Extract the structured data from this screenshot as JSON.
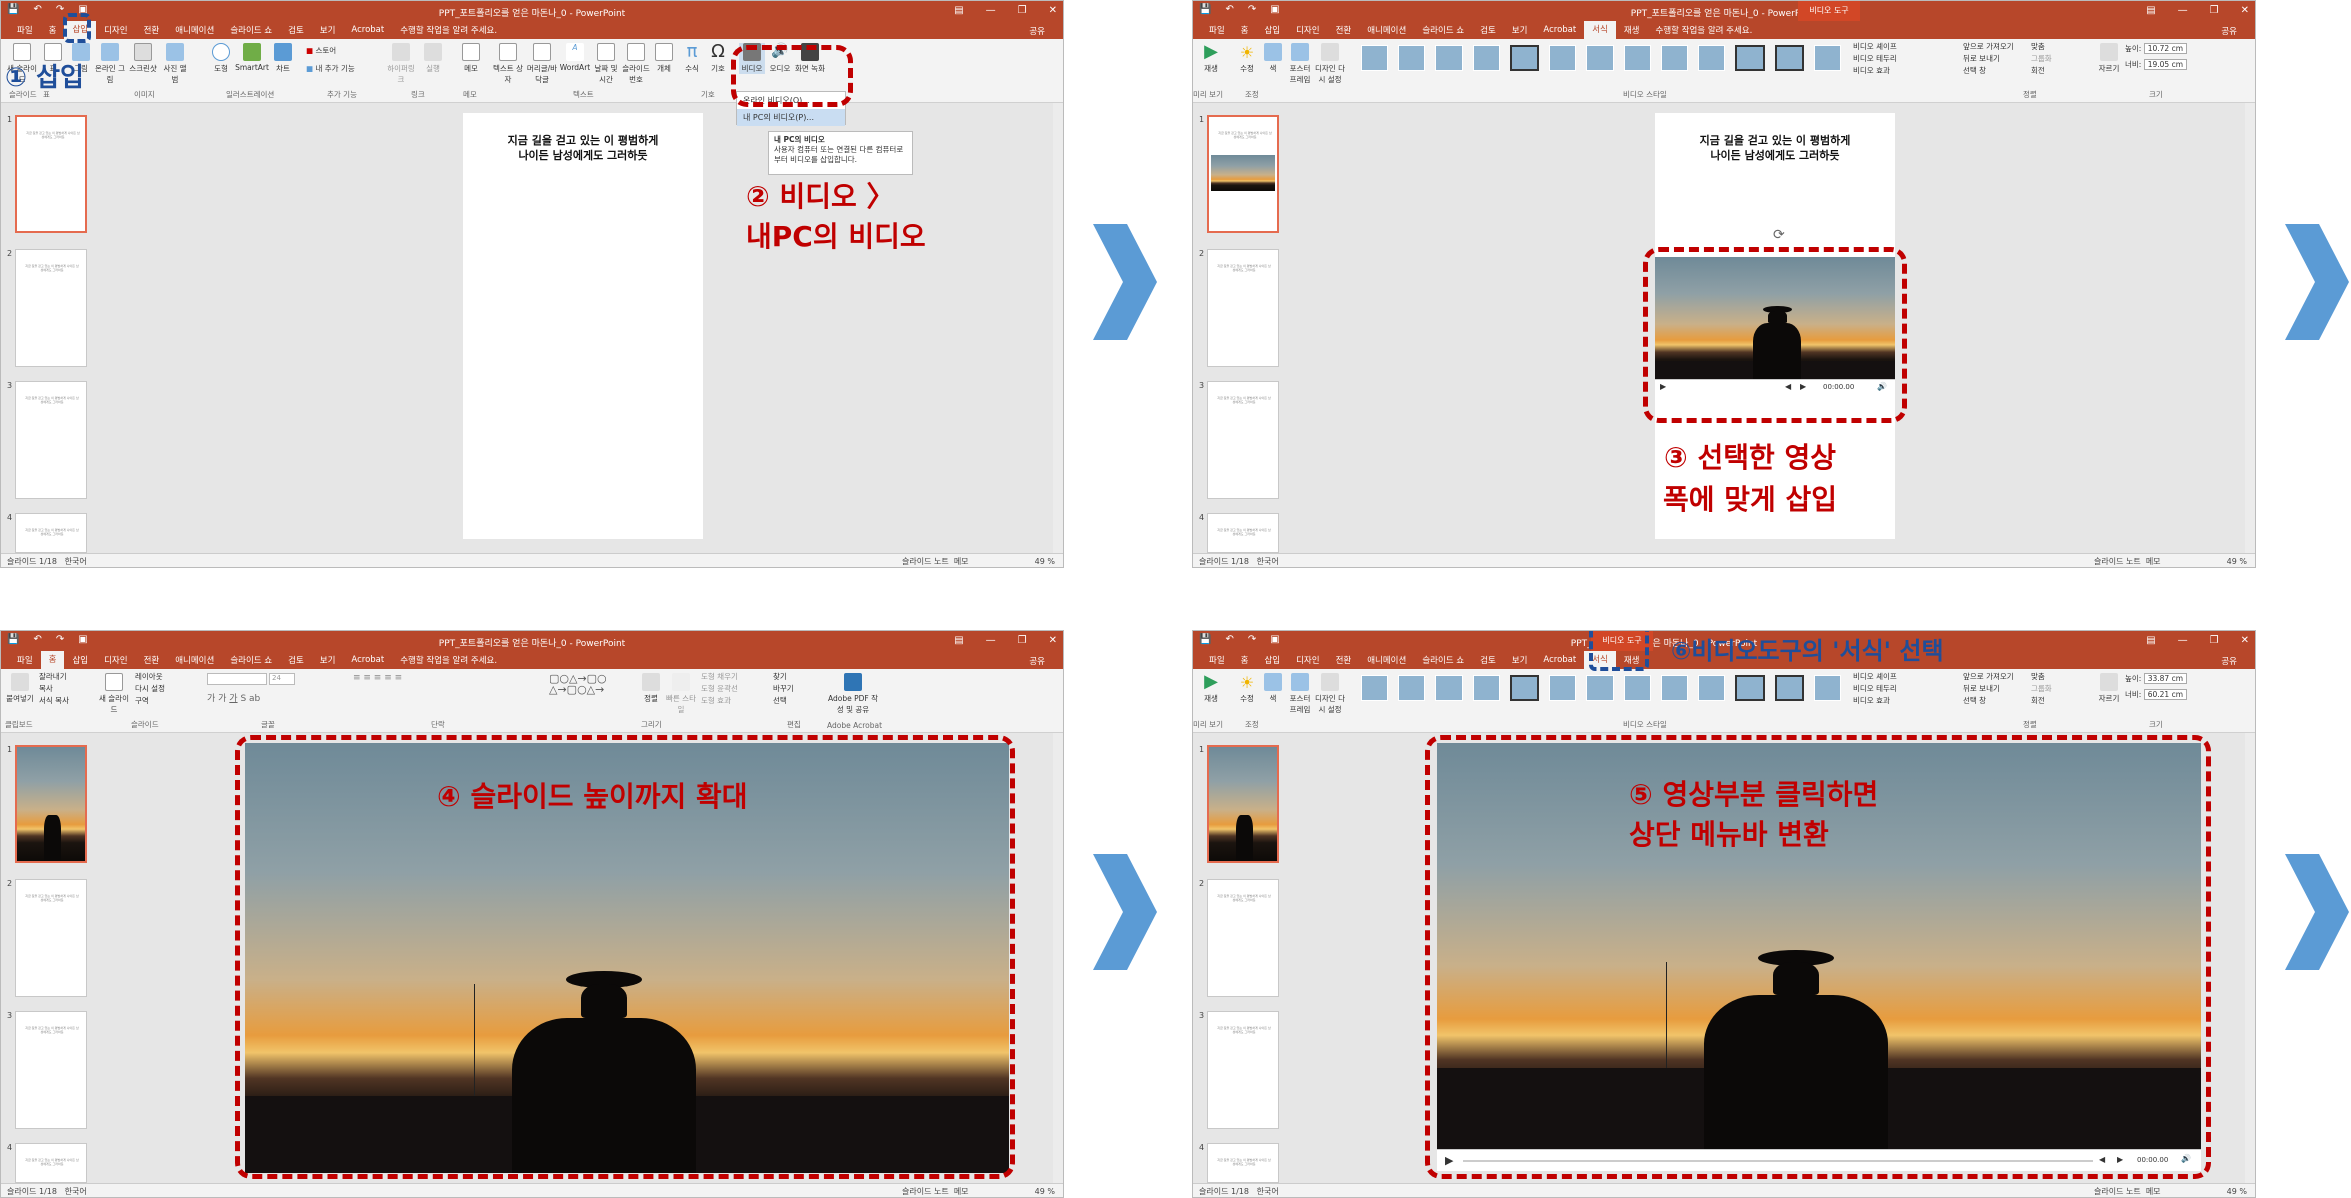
{
  "app": {
    "title_p1": "PPT_포트폴리오를 얻은 마돈나_0 - PowerPoint",
    "title_p2": "PPT_포트폴리오를 얻은 마돈나_0 - PowerPoint",
    "title_p3": "PPT_포트폴리오를 얻은 마돈나_0 - PowerPoint",
    "title_p4": "PPT_포트폴리오를 얻은 마돈나_0 - PowerPoint",
    "video_tools": "비디오 도구",
    "share": "공유",
    "tellme": "수행할 작업을 알려 주세요."
  },
  "tabs_insert": [
    "파일",
    "홈",
    "삽입",
    "디자인",
    "전환",
    "애니메이션",
    "슬라이드 쇼",
    "검토",
    "보기",
    "Acrobat"
  ],
  "tabs_video": [
    "파일",
    "홈",
    "삽입",
    "디자인",
    "전환",
    "애니메이션",
    "슬라이드 쇼",
    "검토",
    "보기",
    "Acrobat",
    "서식",
    "재생"
  ],
  "tabs_home": [
    "파일",
    "홈",
    "삽입",
    "디자인",
    "전환",
    "애니메이션",
    "슬라이드 쇼",
    "검토",
    "보기",
    "Acrobat"
  ],
  "ribbon_insert": {
    "groups": [
      "슬라이드",
      "표",
      "이미지",
      "일러스트레이션",
      "추가 기능",
      "링크",
      "메모",
      "텍스트",
      "기호",
      "미디어"
    ],
    "buttons": [
      "새 슬라이드",
      "표",
      "그림",
      "온라인 그림",
      "스크린샷",
      "사진 앨범",
      "도형",
      "SmartArt",
      "차트",
      "스토어",
      "내 추가 기능",
      "하이퍼링크",
      "실행",
      "메모",
      "텍스트 상자",
      "머리글/바닥글",
      "WordArt",
      "날짜 및 시간",
      "슬라이드 번호",
      "개체",
      "수식",
      "기호",
      "비디오",
      "오디오",
      "화면 녹화"
    ],
    "video_menu": [
      "온라인 비디오(O)...",
      "내 PC의 비디오(P)..."
    ],
    "tooltip_title": "내 PC의 비디오",
    "tooltip_body": "사용자 컴퓨터 또는 연결된 다른 컴퓨터로부터 비디오를 삽입합니다."
  },
  "ribbon_video": {
    "groups": [
      "미리 보기",
      "조정",
      "비디오 스타일",
      "정렬",
      "크기"
    ],
    "buttons": [
      "재생",
      "수정",
      "색",
      "포스터 프레임",
      "디자인 다시 설정",
      "비디오 셰이프",
      "비디오 테두리",
      "비디오 효과",
      "앞으로 가져오기",
      "뒤로 보내기",
      "선택 창",
      "맞춤",
      "그룹화",
      "회전",
      "자르기"
    ],
    "height_p2": "10.72 cm",
    "width_p2": "19.05 cm",
    "height_p4": "33.87 cm",
    "width_p4": "60.21 cm",
    "height_label": "높이:",
    "width_label": "너비:"
  },
  "ribbon_home": {
    "groups": [
      "클립보드",
      "슬라이드",
      "글꼴",
      "단락",
      "그리기",
      "편집",
      "Adobe Acrobat"
    ],
    "buttons": [
      "붙여넣기",
      "잘라내기",
      "복사",
      "서식 복사",
      "새 슬라이드",
      "레이아웃",
      "다시 설정",
      "구역",
      "정렬",
      "빠른 스타일",
      "도형 채우기",
      "도형 윤곽선",
      "도형 효과",
      "찾기",
      "바꾸기",
      "선택",
      "Adobe PDF 작성 및 공유"
    ],
    "font_size": "24"
  },
  "slide_text": [
    "지금 길을 걷고 있는 이 평범하게",
    "나이든 남성에게도 그러하듯"
  ],
  "thumb_text": "지금 길을 걷고 있는 이 평범하게 나이든 남성에게도 그러하듯",
  "thumb_numbers": [
    "1",
    "2",
    "3",
    "4"
  ],
  "video_time": "00:00.00",
  "status": {
    "slide": "슬라이드 1/18",
    "lang": "한국어",
    "notes": "슬라이드 노트",
    "comments": "메모",
    "zoom": "49 %"
  },
  "annotations": {
    "a1": "① 삽입",
    "a2_line1": "② 비디오 〉",
    "a2_line2": "내PC의 비디오",
    "a3_line1": "③ 선택한 영상",
    "a3_line2": "폭에 맞게 삽입",
    "a4": "④ 슬라이드 높이까지 확대",
    "a5_line1": "⑤ 영상부분 클릭하면",
    "a5_line2": "상단 메뉴바 변환",
    "a6": "⑥비디오도구의 '서식' 선택"
  },
  "colors": {
    "ppt_red": "#b7472a",
    "annotation_red": "#c00000",
    "arrow_blue": "#5b9bd5"
  }
}
